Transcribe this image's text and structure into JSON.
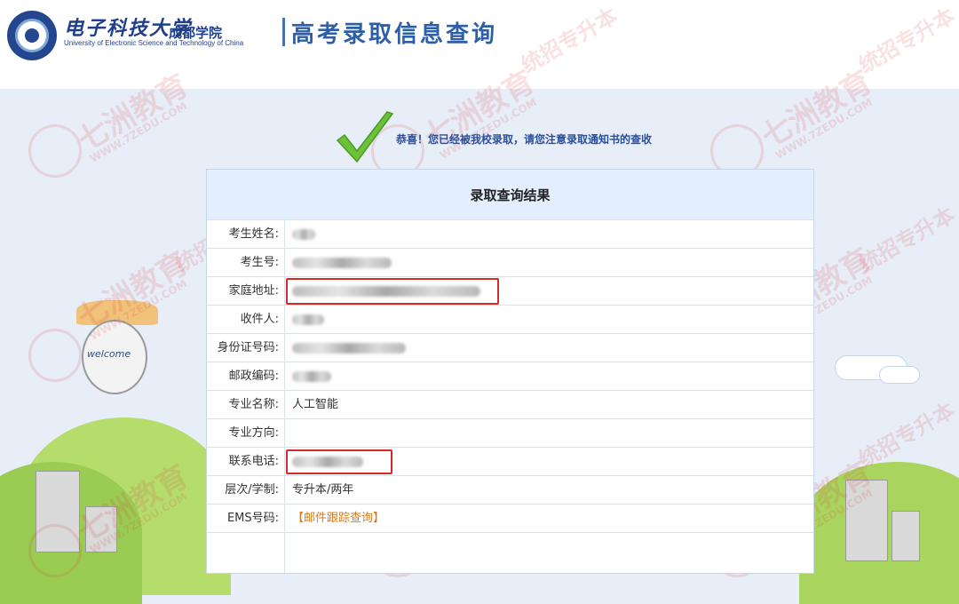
{
  "header": {
    "university_cn": "电子科技大学",
    "campus": "成都学院",
    "university_en": "University of Electronic Science and Technology of China",
    "page_heading": "高考录取信息查询"
  },
  "notice": {
    "congrats": "恭喜！您已经被我校录取，请您注意录取通知书的查收"
  },
  "result": {
    "title": "录取查询结果",
    "rows": [
      {
        "label": "考生姓名:",
        "value": ""
      },
      {
        "label": "考生号:",
        "value": ""
      },
      {
        "label": "家庭地址:",
        "value": ""
      },
      {
        "label": "收件人:",
        "value": ""
      },
      {
        "label": "身份证号码:",
        "value": ""
      },
      {
        "label": "邮政编码:",
        "value": ""
      },
      {
        "label": "专业名称:",
        "value": "人工智能"
      },
      {
        "label": "专业方向:",
        "value": ""
      },
      {
        "label": "联系电话:",
        "value": ""
      },
      {
        "label": "层次/学制:",
        "value": "专升本/两年"
      },
      {
        "label": "EMS号码:",
        "value": "【邮件跟踪查询】"
      }
    ]
  },
  "decor": {
    "balloon_text": "welcome"
  },
  "watermark": {
    "brand": "七洲教育",
    "url": "WWW.7ZEDU.COM",
    "side": "统招专升本"
  },
  "colors": {
    "brand_blue": "#1f3f8a",
    "heading_blue": "#2d5fa8",
    "highlight_red": "#d42a2a",
    "link_orange": "#d97a1a",
    "panel_header": "#e3efff"
  }
}
